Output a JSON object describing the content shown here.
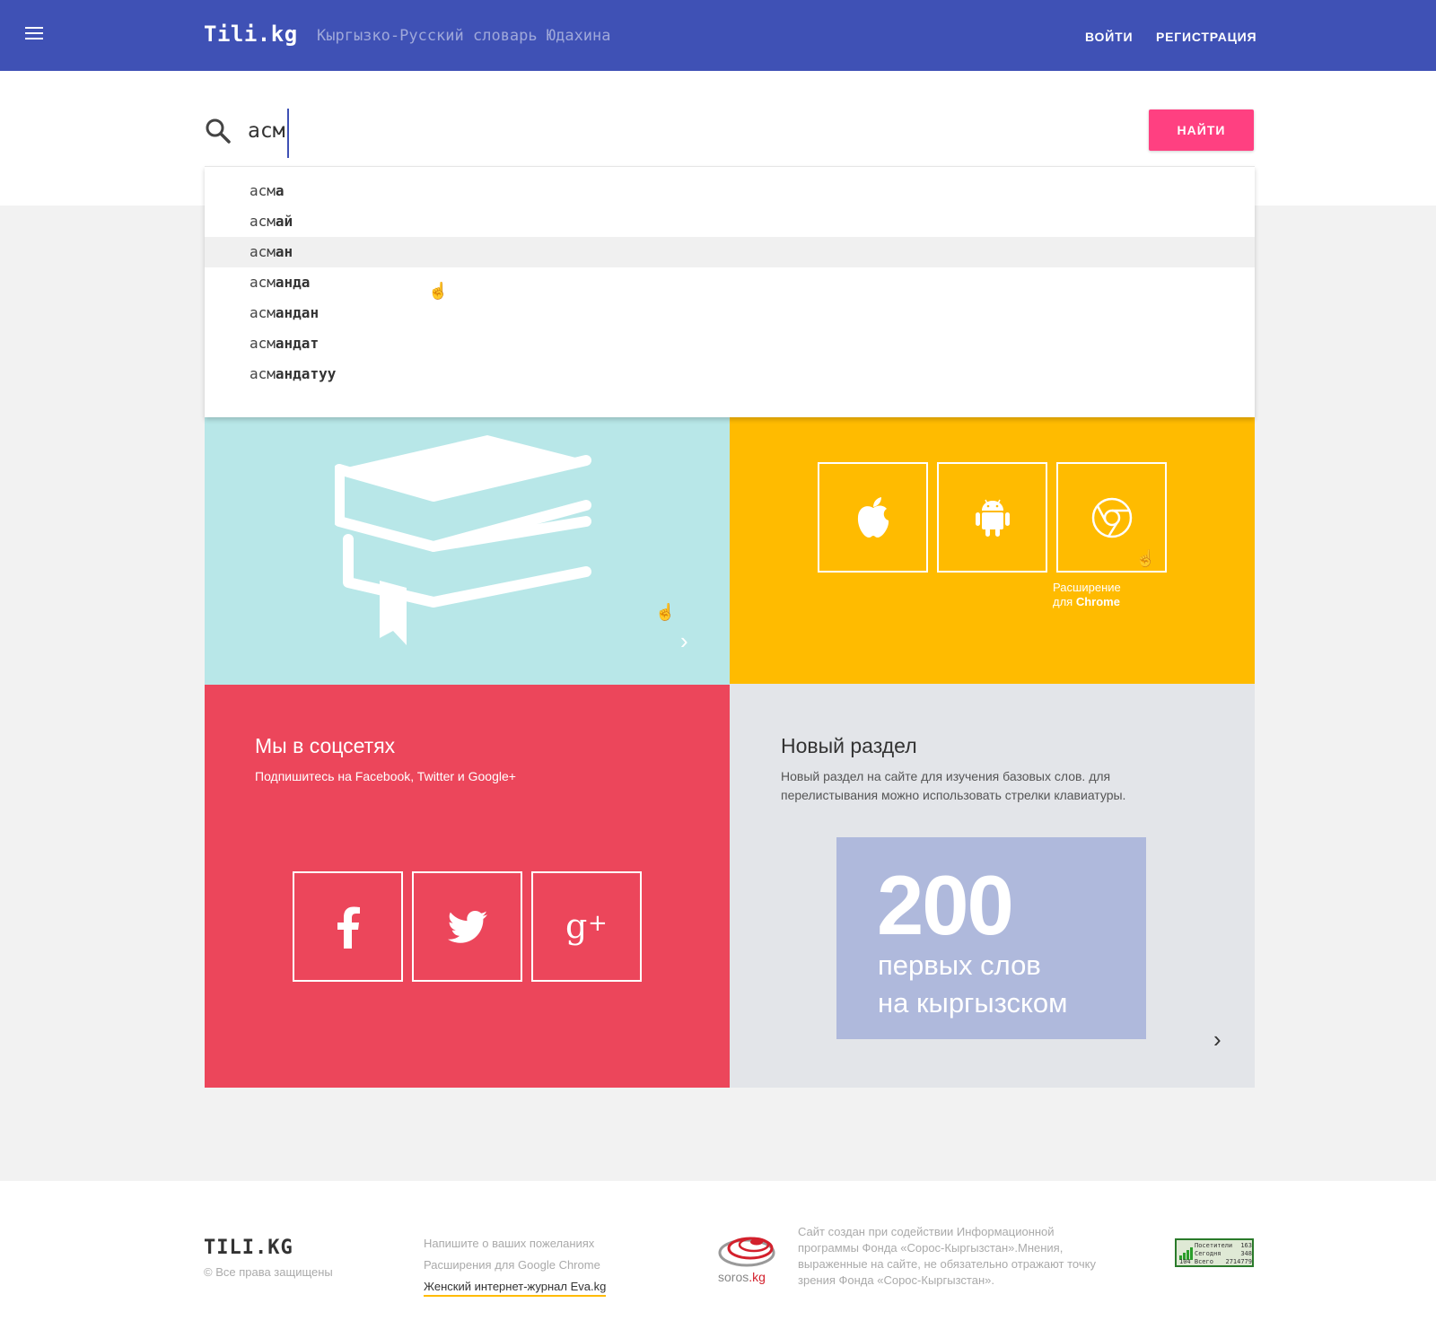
{
  "header": {
    "logo": "Tili.kg",
    "subtitle": "Кыргызко-Русский словарь Юдахина",
    "login": "ВОЙТИ",
    "register": "РЕГИСТРАЦИЯ"
  },
  "search": {
    "value": "асм",
    "button": "НАЙТИ"
  },
  "suggestions": [
    {
      "prefix": "асм",
      "rest": "а"
    },
    {
      "prefix": "асм",
      "rest": "ай"
    },
    {
      "prefix": "асм",
      "rest": "ан"
    },
    {
      "prefix": "асм",
      "rest": "анда"
    },
    {
      "prefix": "асм",
      "rest": "андан"
    },
    {
      "prefix": "асм",
      "rest": "андат"
    },
    {
      "prefix": "асм",
      "rest": "андатуу"
    }
  ],
  "apps": {
    "chrome_caption_line1": "Расширение",
    "chrome_caption_prefix": "для ",
    "chrome_caption_bold": "Chrome"
  },
  "social": {
    "title": "Мы в соцсетях",
    "text": "Подпишитесь на Facebook, Twitter и Google+"
  },
  "new_section": {
    "title": "Новый раздел",
    "text": "Новый раздел на сайте для изучения базовых слов. для перелистывания можно использовать стрелки клавиатуры.",
    "number": "200",
    "caption_line1": "первых слов",
    "caption_line2": "на кыргызском"
  },
  "footer": {
    "logo": "TILI.KG",
    "copyright": "© Все права защищены",
    "links": [
      "Напишите о ваших пожеланиях",
      "Расширения для Google Chrome",
      "Женский интернет-журнал Eva.kg"
    ],
    "soros_name": "soros",
    "soros_domain": ".kg",
    "about": "Сайт создан при содействии Информационной программы Фонда «Сорос-Кыргызстан».Мнения, выраженные на сайте, не обязательно отражают точку зрения Фонда «Сорос-Кыргызстан».",
    "counter": {
      "label1": "Посетители",
      "value1": "163",
      "label2": "Сегодня",
      "value2": "348",
      "prefix3": "104",
      "label3": "Всего",
      "value3": "2714779"
    }
  },
  "colors": {
    "header": "#3f51b5",
    "accent": "#ff4081",
    "tile_book": "#b8e7e8",
    "tile_apps": "#ffbb00",
    "tile_social": "#ec465b",
    "tile_new": "#e3e5e9"
  },
  "icons": [
    "menu-icon",
    "search-icon",
    "book-icon",
    "apple-icon",
    "android-icon",
    "chrome-icon",
    "facebook-icon",
    "twitter-icon",
    "google-plus-icon",
    "chevron-right-icon"
  ]
}
